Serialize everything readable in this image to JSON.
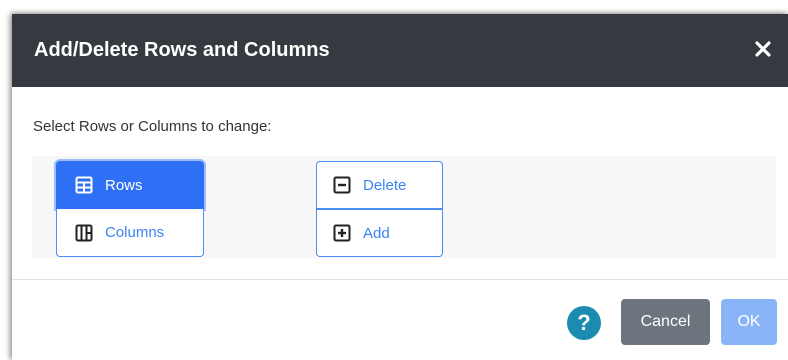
{
  "dialog": {
    "title": "Add/Delete Rows and Columns",
    "close_icon": "close-icon",
    "prompt": "Select Rows or Columns to change:"
  },
  "target_group": {
    "items": [
      {
        "label": "Rows",
        "icon": "rows-icon",
        "selected": true
      },
      {
        "label": "Columns",
        "icon": "columns-icon",
        "selected": false
      }
    ]
  },
  "action_group": {
    "items": [
      {
        "label": "Delete",
        "icon": "delete-box-icon"
      },
      {
        "label": "Add",
        "icon": "add-box-icon"
      }
    ]
  },
  "footer": {
    "help_label": "?",
    "cancel_label": "Cancel",
    "ok_label": "OK"
  },
  "colors": {
    "header_bg": "#343a40",
    "primary": "#2f6ff5",
    "secondary": "#6c757d",
    "help": "#1c8bb0"
  }
}
